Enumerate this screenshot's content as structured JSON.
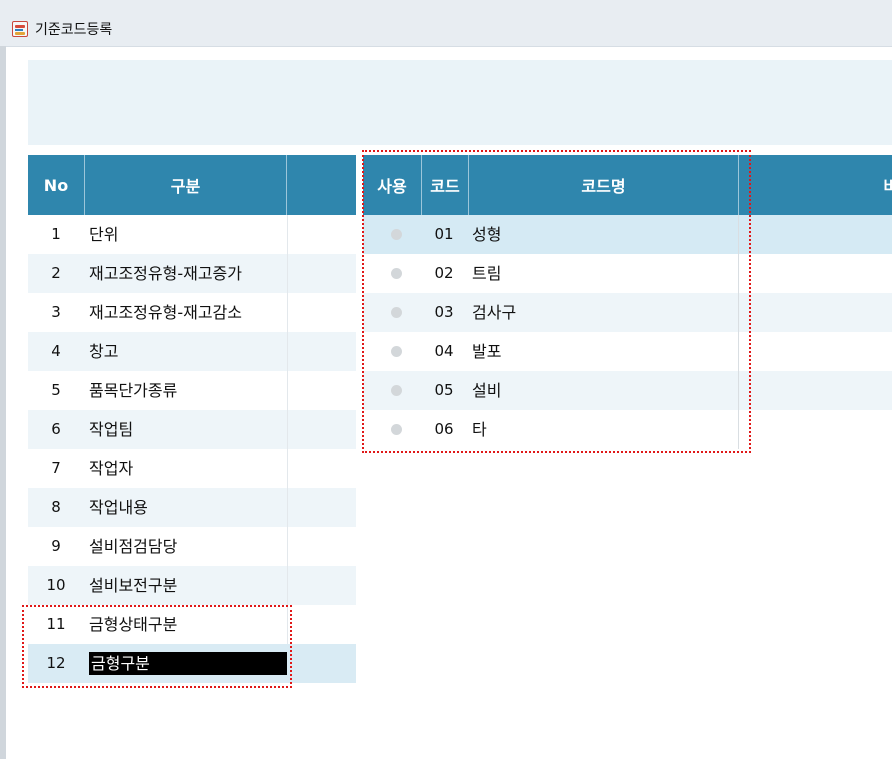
{
  "window": {
    "title": "기준코드등록"
  },
  "left_grid": {
    "headers": {
      "no": "No",
      "category": "구분"
    },
    "rows": [
      {
        "no": "1",
        "name": "단위"
      },
      {
        "no": "2",
        "name": "재고조정유형-재고증가"
      },
      {
        "no": "3",
        "name": "재고조정유형-재고감소"
      },
      {
        "no": "4",
        "name": "창고"
      },
      {
        "no": "5",
        "name": "품목단가종류"
      },
      {
        "no": "6",
        "name": "작업팀"
      },
      {
        "no": "7",
        "name": "작업자"
      },
      {
        "no": "8",
        "name": "작업내용"
      },
      {
        "no": "9",
        "name": "설비점검담당"
      },
      {
        "no": "10",
        "name": "설비보전구분"
      },
      {
        "no": "11",
        "name": "금형상태구분"
      },
      {
        "no": "12",
        "name": "금형구분"
      }
    ],
    "selected_index": 11
  },
  "right_grid": {
    "headers": {
      "use": "사용",
      "code": "코드",
      "code_name": "코드명",
      "note_partial": "비"
    },
    "rows": [
      {
        "use": false,
        "code": "01",
        "name": "성형"
      },
      {
        "use": false,
        "code": "02",
        "name": "트림"
      },
      {
        "use": false,
        "code": "03",
        "name": "검사구"
      },
      {
        "use": false,
        "code": "04",
        "name": "발포"
      },
      {
        "use": false,
        "code": "05",
        "name": "설비"
      },
      {
        "use": false,
        "code": "06",
        "name": "타"
      }
    ]
  },
  "colors": {
    "header_bg": "#2f86ad",
    "selected_row_bg": "#d9ebf4",
    "alt_row_bg": "#eef5f9",
    "highlight_annotation": "#e01818"
  }
}
